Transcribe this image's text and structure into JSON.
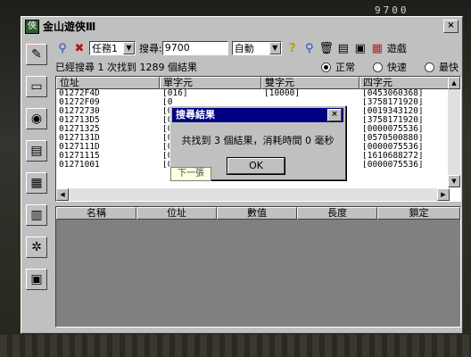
{
  "game": {
    "score": "9700"
  },
  "window": {
    "title": "金山遊俠Ⅲ",
    "icon_text": "俠",
    "close": "×"
  },
  "toolbar": {
    "task_select": "任務1",
    "search_label": "搜尋:",
    "search_value": "9700",
    "mode_select": "自動",
    "games_label": "遊戲"
  },
  "status": {
    "summary": "已經搜尋 1 次找到 1289 個結果",
    "radio_normal": "正常",
    "radio_fast": "快速",
    "radio_fastest": "最快"
  },
  "results": {
    "columns": [
      "位址",
      "單字元",
      "雙字元",
      "四字元"
    ],
    "rows": [
      [
        "01272F4D",
        "[016]",
        "[10000]",
        "[0453060368]"
      ],
      [
        "01272F09",
        "[0",
        "",
        "[3758171920]"
      ],
      [
        "01272730",
        "[0",
        "",
        "[0019343120]"
      ],
      [
        "012713D5",
        "[0",
        "",
        "[3758171920]"
      ],
      [
        "01271325",
        "[0",
        "",
        "[0000075536]"
      ],
      [
        "0127131D",
        "[0",
        "",
        "[0570500880]"
      ],
      [
        "0127111D",
        "[0",
        "",
        "[0000075536]"
      ],
      [
        "01271115",
        "[0",
        "",
        "[1610688272]"
      ],
      [
        "01271001",
        "[0",
        "",
        "[0000075536]"
      ]
    ]
  },
  "lock_table": {
    "columns": [
      "名稱",
      "位址",
      "數值",
      "長度",
      "鎖定"
    ]
  },
  "dialog": {
    "title": "搜尋結果",
    "message": "共找到 3 個結果，消耗時間 0 毫秒",
    "ok": "OK",
    "close": "×"
  },
  "tooltip": "下一張"
}
